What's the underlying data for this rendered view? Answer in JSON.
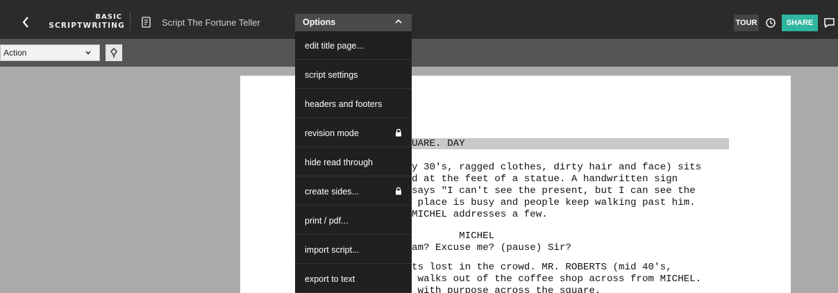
{
  "header": {
    "logo_line1": "BASIC",
    "logo_line2": "SCRIPTWRITING",
    "script_title": "Script The Fortune Teller",
    "options_label": "Options",
    "tour_label": "TOUR",
    "share_label": "SHARE"
  },
  "toolbar": {
    "element_type": "Action"
  },
  "menu": {
    "items": [
      {
        "label": "edit title page...",
        "locked": false
      },
      {
        "label": "script settings",
        "locked": false
      },
      {
        "label": "headers and footers",
        "locked": false
      },
      {
        "label": "revision mode",
        "locked": true
      },
      {
        "label": "hide read through",
        "locked": false
      },
      {
        "label": "create sides...",
        "locked": true
      },
      {
        "label": "print / pdf...",
        "locked": false
      },
      {
        "label": "import script...",
        "locked": false
      },
      {
        "label": "export to text",
        "locked": false
      }
    ]
  },
  "script": {
    "lines": [
      "UARE. DAY",
      "y 30's, ragged clothes, dirty hair and face) sits",
      "d at the feet of a statue. A handwritten sign",
      "says \"I can't see the present, but I can see the",
      " place is busy and people keep walking past him.",
      "MICHEL addresses a few.",
      "        MICHEL",
      "am? Excuse me? (pause) Sir?",
      "ts lost in the crowd. MR. ROBERTS (mid 40's,",
      " walks out of the coffee shop across from MICHEL.",
      " with purpose across the square."
    ]
  },
  "colors": {
    "topbar": "#2b2b2b",
    "toolbar": "#555555",
    "menu_bg": "#202020",
    "share": "#2fb6a0",
    "workspace": "#aaaaaa",
    "slug_highlight": "#c9c9c9"
  },
  "icons": {
    "back": "chevron-left-icon",
    "document": "document-icon",
    "options_toggle": "chevron-up-icon",
    "history": "clock-icon",
    "comments": "chat-bubble-icon",
    "element_caret": "chevron-down-icon",
    "marker": "marker-icon",
    "locked_item": "lock-icon"
  }
}
